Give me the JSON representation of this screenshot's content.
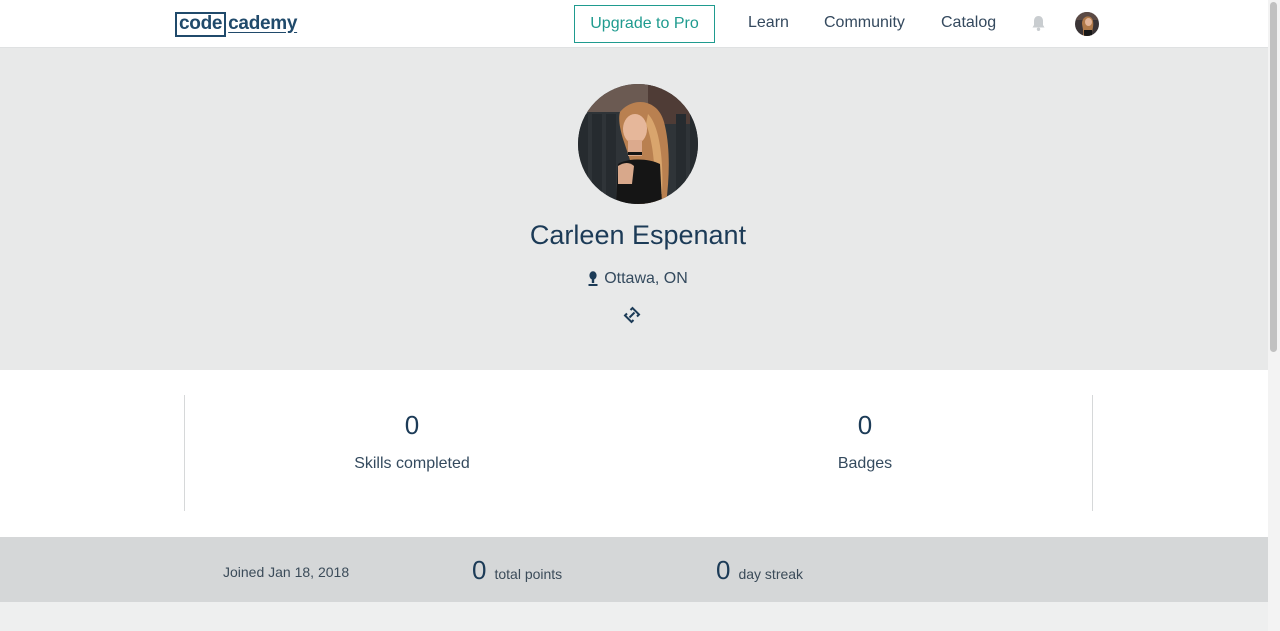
{
  "header": {
    "logo_left": "code",
    "logo_right": "cademy",
    "upgrade_label": "Upgrade to Pro",
    "nav": [
      "Learn",
      "Community",
      "Catalog"
    ]
  },
  "profile": {
    "name": "Carleen Espenant",
    "location": "Ottawa, ON"
  },
  "stats": [
    {
      "value": "0",
      "label": "Skills completed"
    },
    {
      "value": "0",
      "label": "Badges"
    }
  ],
  "strip": {
    "joined": "Joined Jan 18, 2018",
    "points_value": "0",
    "points_label": "total points",
    "streak_value": "0",
    "streak_label": "day streak"
  },
  "colors": {
    "brand": "#204a6b",
    "accent": "#1f9b8f",
    "hero_bg": "#e8e9e9",
    "strip_bg": "#d5d7d8"
  },
  "icons": [
    "bell-icon",
    "location-pin-icon",
    "link-icon"
  ]
}
